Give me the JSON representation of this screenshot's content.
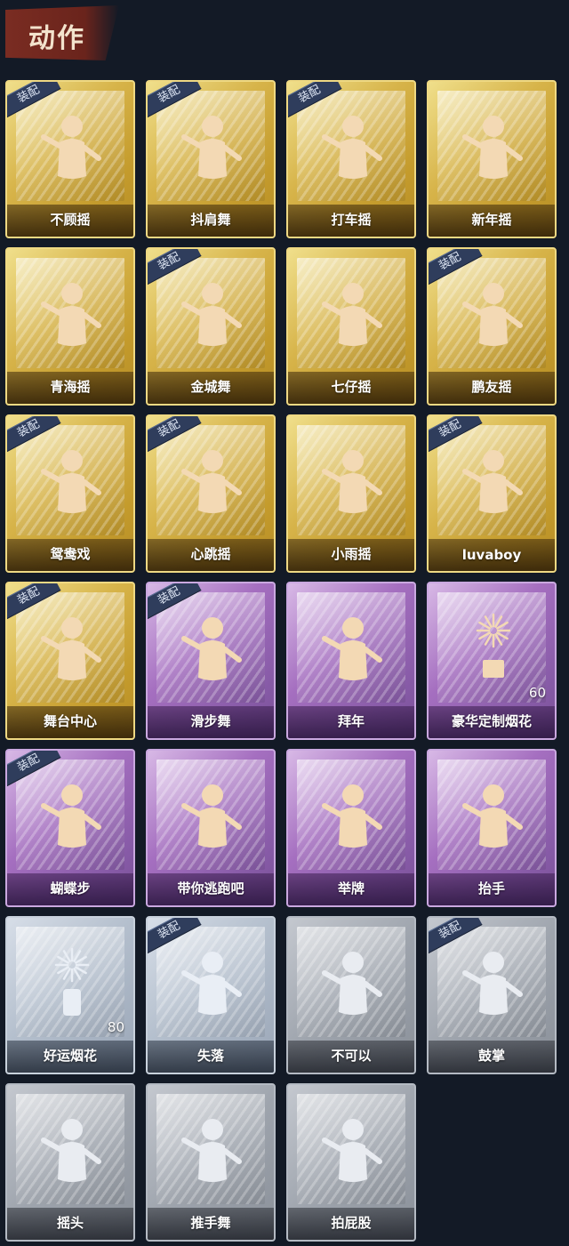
{
  "header": {
    "title": "动作"
  },
  "equipped_label": "装配",
  "colors": {
    "gold": "#d7b44a",
    "purple": "#a56fc0",
    "silver": "#b4bfcd",
    "gray": "#9ea4ad",
    "background": "#131a26"
  },
  "actions": [
    {
      "label": "不顾摇",
      "rarity": "gold",
      "equipped": true,
      "count": "",
      "icon": "dance-figure-icon"
    },
    {
      "label": "抖肩舞",
      "rarity": "gold",
      "equipped": true,
      "count": "",
      "icon": "dance-figure-icon"
    },
    {
      "label": "打车摇",
      "rarity": "gold",
      "equipped": true,
      "count": "",
      "icon": "dance-figure-icon"
    },
    {
      "label": "新年摇",
      "rarity": "gold",
      "equipped": false,
      "count": "",
      "icon": "dance-figure-icon"
    },
    {
      "label": "青海摇",
      "rarity": "gold",
      "equipped": false,
      "count": "",
      "icon": "dance-figure-icon"
    },
    {
      "label": "金城舞",
      "rarity": "gold",
      "equipped": true,
      "count": "",
      "icon": "dance-figure-icon"
    },
    {
      "label": "七仔摇",
      "rarity": "gold",
      "equipped": false,
      "count": "",
      "icon": "dance-figure-icon"
    },
    {
      "label": "鹏友摇",
      "rarity": "gold",
      "equipped": true,
      "count": "",
      "icon": "dance-figure-icon"
    },
    {
      "label": "鸳鸯戏",
      "rarity": "gold",
      "equipped": true,
      "count": "",
      "icon": "dance-figure-icon"
    },
    {
      "label": "心跳摇",
      "rarity": "gold",
      "equipped": true,
      "count": "",
      "icon": "dance-figure-icon"
    },
    {
      "label": "小雨摇",
      "rarity": "gold",
      "equipped": false,
      "count": "",
      "icon": "dance-figure-icon"
    },
    {
      "label": "luvaboy",
      "rarity": "gold",
      "equipped": true,
      "count": "",
      "icon": "dance-figure-icon"
    },
    {
      "label": "舞台中心",
      "rarity": "gold",
      "equipped": true,
      "count": "",
      "icon": "dance-figure-icon"
    },
    {
      "label": "滑步舞",
      "rarity": "purple",
      "equipped": true,
      "count": "",
      "icon": "dance-figure-icon"
    },
    {
      "label": "拜年",
      "rarity": "purple",
      "equipped": false,
      "count": "",
      "icon": "greeting-figure-icon"
    },
    {
      "label": "豪华定制烟花",
      "rarity": "purple",
      "equipped": false,
      "count": "60",
      "icon": "fireworks-icon"
    },
    {
      "label": "蝴蝶步",
      "rarity": "purple",
      "equipped": true,
      "count": "",
      "icon": "dance-figure-icon"
    },
    {
      "label": "带你逃跑吧",
      "rarity": "purple",
      "equipped": false,
      "count": "",
      "icon": "dance-figure-icon"
    },
    {
      "label": "举牌",
      "rarity": "purple",
      "equipped": false,
      "count": "",
      "icon": "sign-figure-icon"
    },
    {
      "label": "抬手",
      "rarity": "purple",
      "equipped": false,
      "count": "",
      "icon": "raise-hand-icon"
    },
    {
      "label": "好运烟花",
      "rarity": "silver",
      "equipped": false,
      "count": "80",
      "icon": "firework-can-icon"
    },
    {
      "label": "失落",
      "rarity": "silver",
      "equipped": true,
      "count": "",
      "icon": "crawling-figure-icon"
    },
    {
      "label": "不可以",
      "rarity": "gray",
      "equipped": false,
      "count": "",
      "icon": "finger-wag-icon"
    },
    {
      "label": "鼓掌",
      "rarity": "gray",
      "equipped": true,
      "count": "",
      "icon": "clapping-icon"
    },
    {
      "label": "摇头",
      "rarity": "gray",
      "equipped": false,
      "count": "",
      "icon": "head-shake-icon"
    },
    {
      "label": "推手舞",
      "rarity": "gray",
      "equipped": false,
      "count": "",
      "icon": "push-hands-icon"
    },
    {
      "label": "拍屁股",
      "rarity": "gray",
      "equipped": false,
      "count": "",
      "icon": "butt-slap-icon"
    }
  ]
}
